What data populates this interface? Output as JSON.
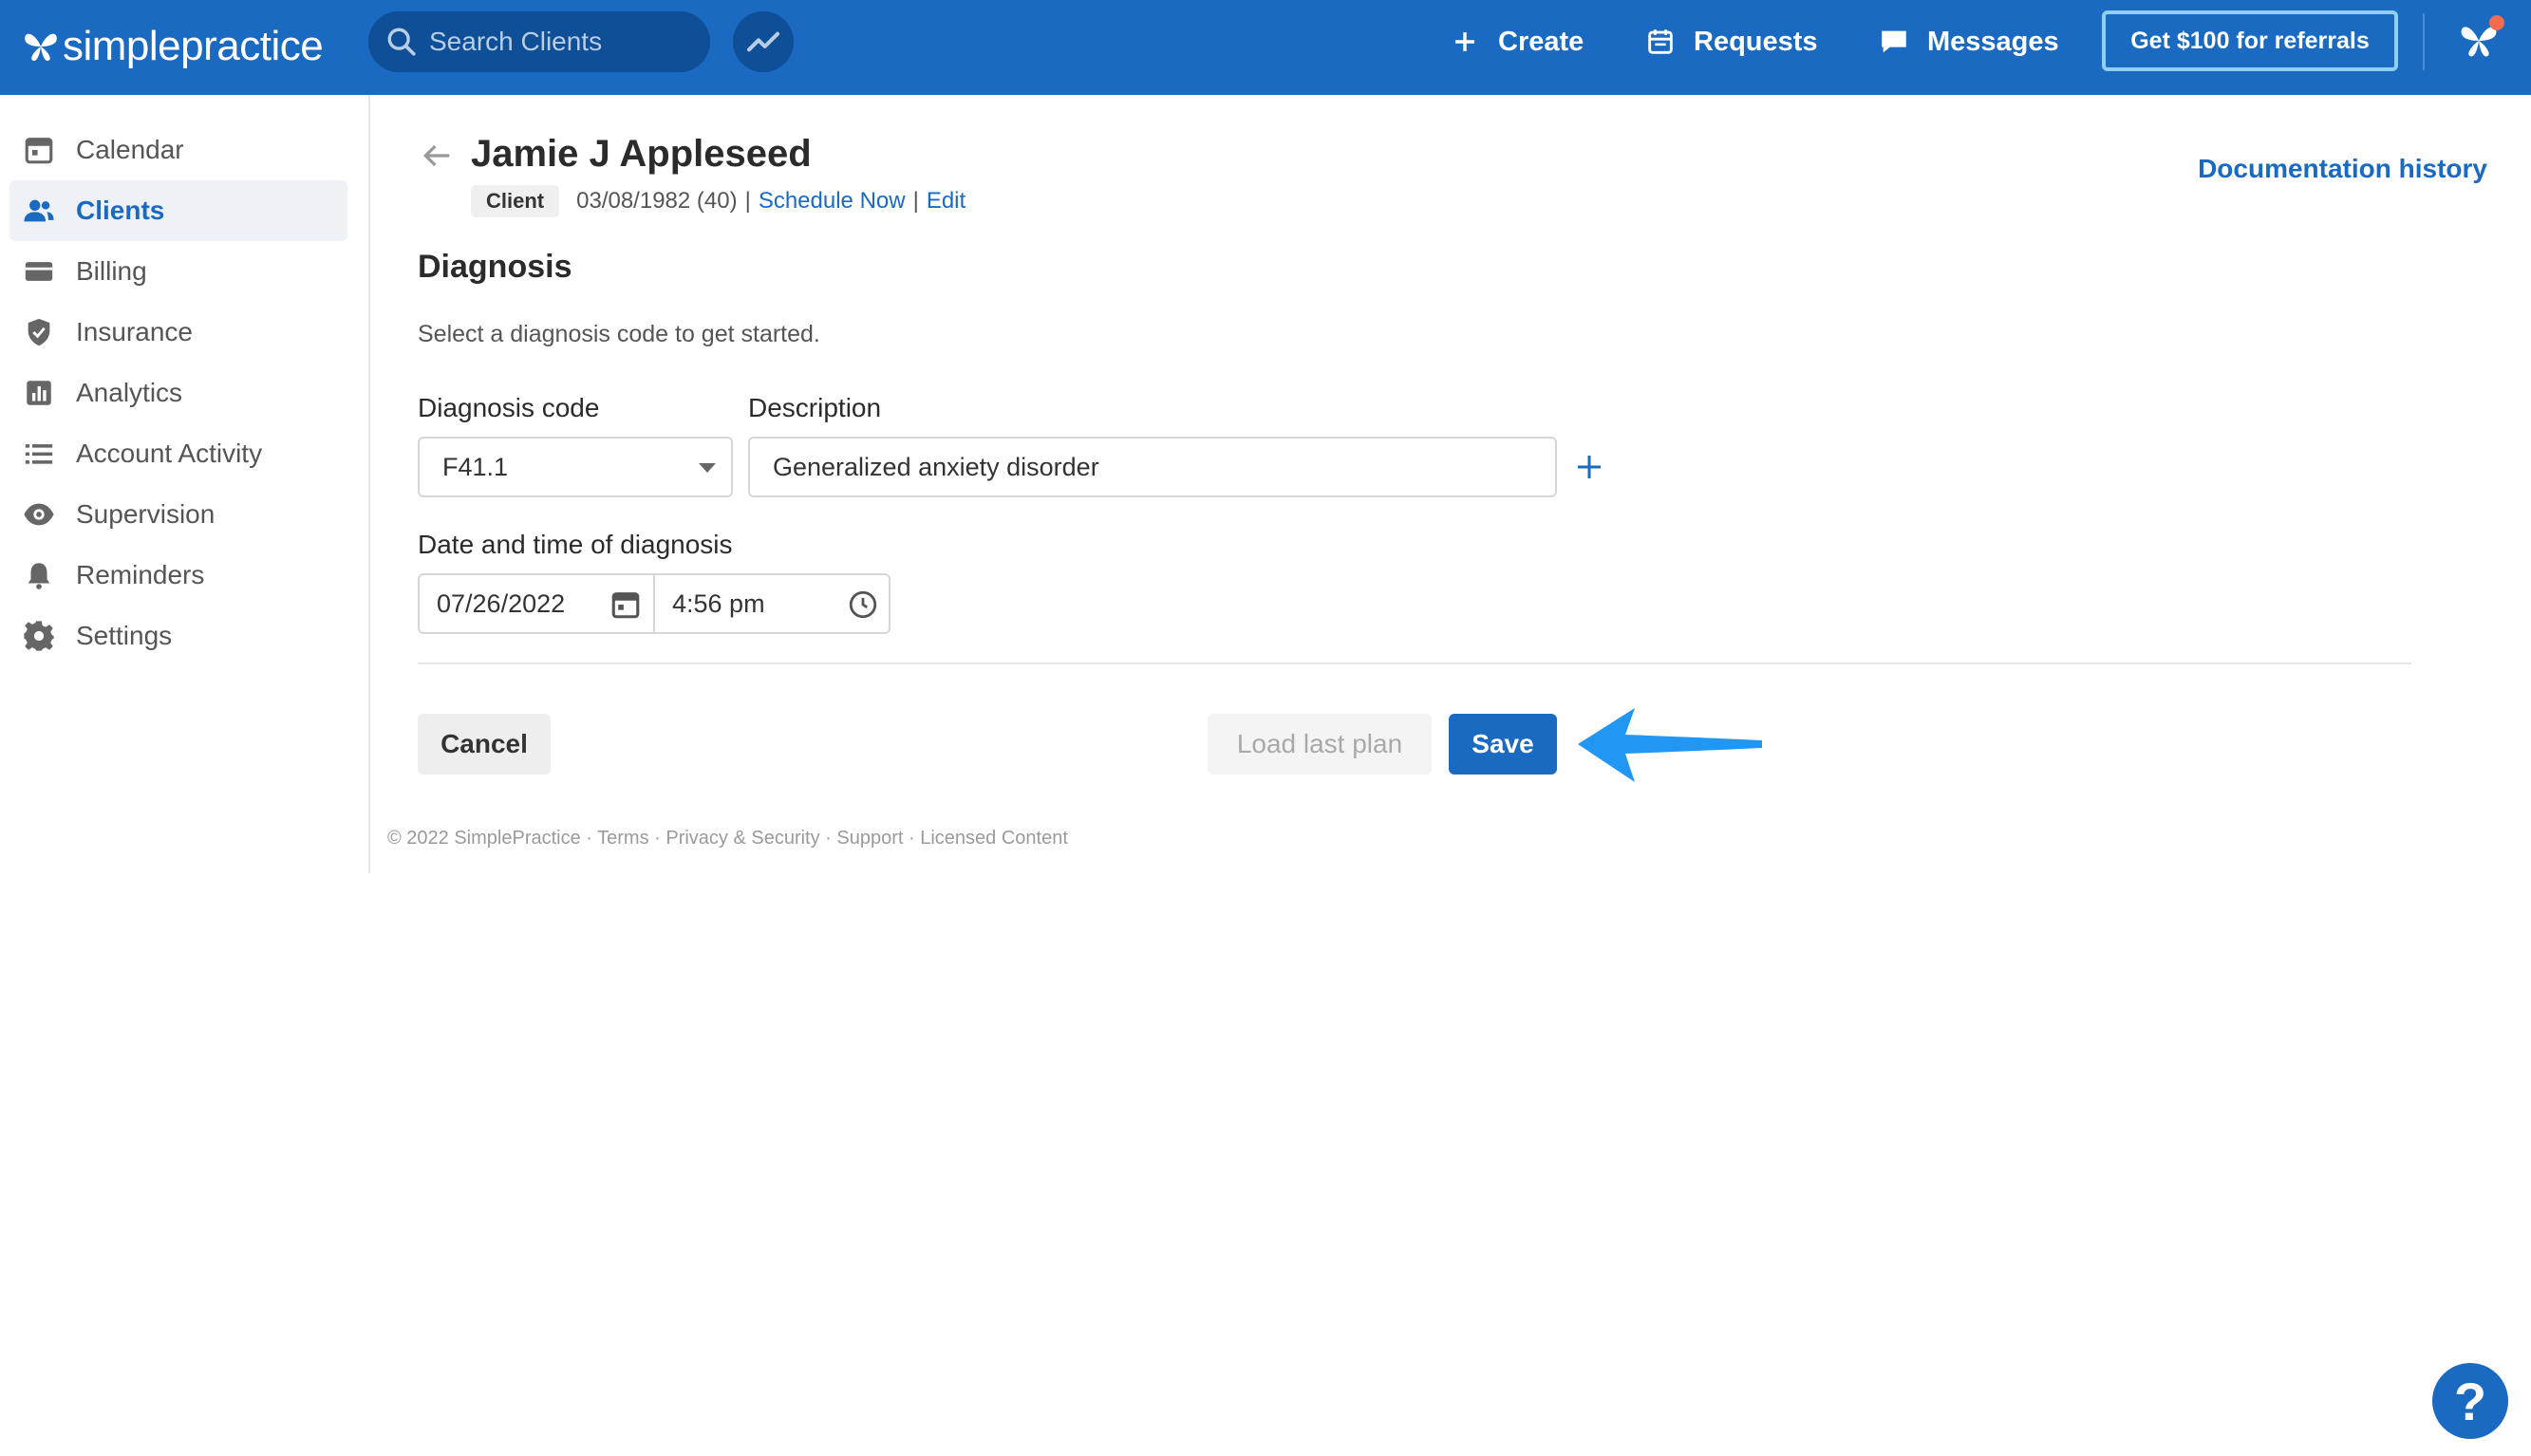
{
  "app": {
    "logo_text": "simplepractice"
  },
  "topbar": {
    "search_placeholder": "Search Clients",
    "create_label": "Create",
    "requests_label": "Requests",
    "messages_label": "Messages",
    "referral_label": "Get $100 for referrals"
  },
  "sidebar": {
    "items": [
      {
        "label": "Calendar",
        "icon": "calendar-icon"
      },
      {
        "label": "Clients",
        "icon": "clients-icon",
        "active": true
      },
      {
        "label": "Billing",
        "icon": "billing-icon"
      },
      {
        "label": "Insurance",
        "icon": "shield-icon"
      },
      {
        "label": "Analytics",
        "icon": "bar-chart-icon"
      },
      {
        "label": "Account Activity",
        "icon": "list-icon"
      },
      {
        "label": "Supervision",
        "icon": "eye-icon"
      },
      {
        "label": "Reminders",
        "icon": "bell-icon"
      },
      {
        "label": "Settings",
        "icon": "gear-icon"
      }
    ]
  },
  "client": {
    "name": "Jamie J Appleseed",
    "badge": "Client",
    "dob": "03/08/1982 (40)",
    "separator": "|",
    "schedule_label": "Schedule Now",
    "edit_label": "Edit"
  },
  "header": {
    "doc_history_label": "Documentation history"
  },
  "diagnosis": {
    "title": "Diagnosis",
    "hint": "Select a diagnosis code to get started.",
    "code_label": "Diagnosis code",
    "code_value": "F41.1",
    "description_label": "Description",
    "description_value": "Generalized anxiety disorder",
    "datetime_label": "Date and time of diagnosis",
    "date_value": "07/26/2022",
    "time_value": "4:56 pm"
  },
  "actions": {
    "cancel_label": "Cancel",
    "load_label": "Load last plan",
    "save_label": "Save"
  },
  "footer": {
    "text": "© 2022 SimplePractice · Terms · Privacy & Security · Support · Licensed Content"
  },
  "help": {
    "label": "?"
  },
  "colors": {
    "brand": "#1a6ac2",
    "annotation_arrow": "#2196f3",
    "notification_dot": "#f26b4d"
  }
}
